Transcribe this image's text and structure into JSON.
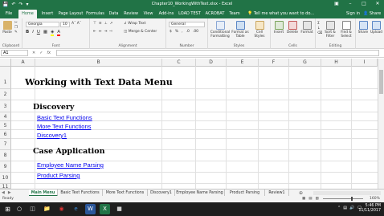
{
  "window": {
    "title": "Chapter10_WorkingWithText.xlsx - Excel"
  },
  "ribbon_tabs": [
    "File",
    "Home",
    "Insert",
    "Page Layout",
    "Formulas",
    "Data",
    "Review",
    "View",
    "Add-ins",
    "LOAD TEST",
    "ACROBAT",
    "Team"
  ],
  "active_tab": "Home",
  "tell_me": "Tell me what you want to do...",
  "account": {
    "sign_in": "Sign in",
    "share": "Share"
  },
  "ribbon": {
    "clipboard": {
      "label": "Clipboard",
      "paste": "Paste"
    },
    "font": {
      "label": "Font",
      "name": "Georgia",
      "size": "10"
    },
    "alignment": {
      "label": "Alignment",
      "wrap": "Wrap Text",
      "merge": "Merge & Center"
    },
    "number": {
      "label": "Number",
      "format": "General"
    },
    "styles": {
      "label": "Styles",
      "conditional": "Conditional Formatting",
      "format_table": "Format as Table",
      "cell_styles": "Cell Styles"
    },
    "cells": {
      "label": "Cells",
      "insert": "Insert",
      "delete": "Delete",
      "format": "Format"
    },
    "editing": {
      "label": "Editing",
      "sort": "Sort & Filter",
      "find": "Find & Select"
    },
    "extra": {
      "share": "Share",
      "upload": "Upload"
    }
  },
  "formula_bar": {
    "name_box": "A1",
    "value": ""
  },
  "columns": [
    "A",
    "B",
    "C",
    "D",
    "E",
    "F",
    "G",
    "H",
    "I"
  ],
  "rows": [
    "1",
    "2",
    "3",
    "4",
    "5",
    "6",
    "7",
    "8",
    "9",
    "10",
    "11"
  ],
  "cells": {
    "title": "Working with Text Data Menu",
    "discovery": "Discovery",
    "basic_text": "Basic Text Functions",
    "more_text": "More Text Functions",
    "discovery1": "Discovery1",
    "case_app": "Case Application",
    "employee": "Employee Name Parsing",
    "product": "Product Parsing"
  },
  "sheet_tabs": [
    "Main Menu",
    "Basic Text Functions",
    "More Text Functions",
    "Discovery1",
    "Employee Name Parsing",
    "Product Parsing",
    "Review1"
  ],
  "active_sheet": "Main Menu",
  "status": {
    "ready": "Ready",
    "zoom": "160%"
  },
  "clock": {
    "time": "5:46 PM",
    "date": "11/11/2017"
  },
  "colors": {
    "excel_green": "#217346",
    "link_blue": "#0000ee"
  }
}
